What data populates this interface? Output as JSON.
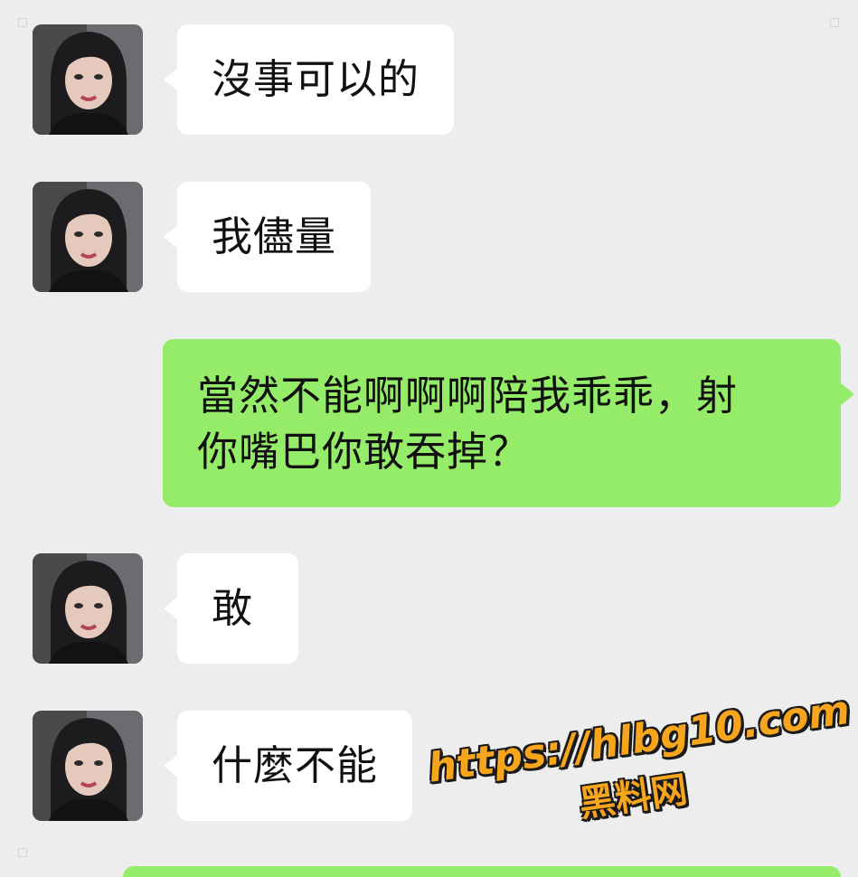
{
  "messages": [
    {
      "side": "in",
      "text": "沒事可以的"
    },
    {
      "side": "in",
      "text": "我儘量"
    },
    {
      "side": "out",
      "lines": [
        "當然不能啊啊啊陪我乖乖，射",
        "你嘴巴你敢吞掉？"
      ]
    },
    {
      "side": "in",
      "text": "敢"
    },
    {
      "side": "in",
      "text": "什麼不能"
    },
    {
      "side": "out",
      "lines": []
    }
  ],
  "watermark": {
    "url": "https://hlbg10.com",
    "name": "黑料网",
    "color": "#f6a51c"
  },
  "colors": {
    "background": "#ededed",
    "incoming_bubble": "#ffffff",
    "outgoing_bubble": "#95ec69"
  },
  "avatar": {
    "icon": "contact-avatar-photo"
  }
}
